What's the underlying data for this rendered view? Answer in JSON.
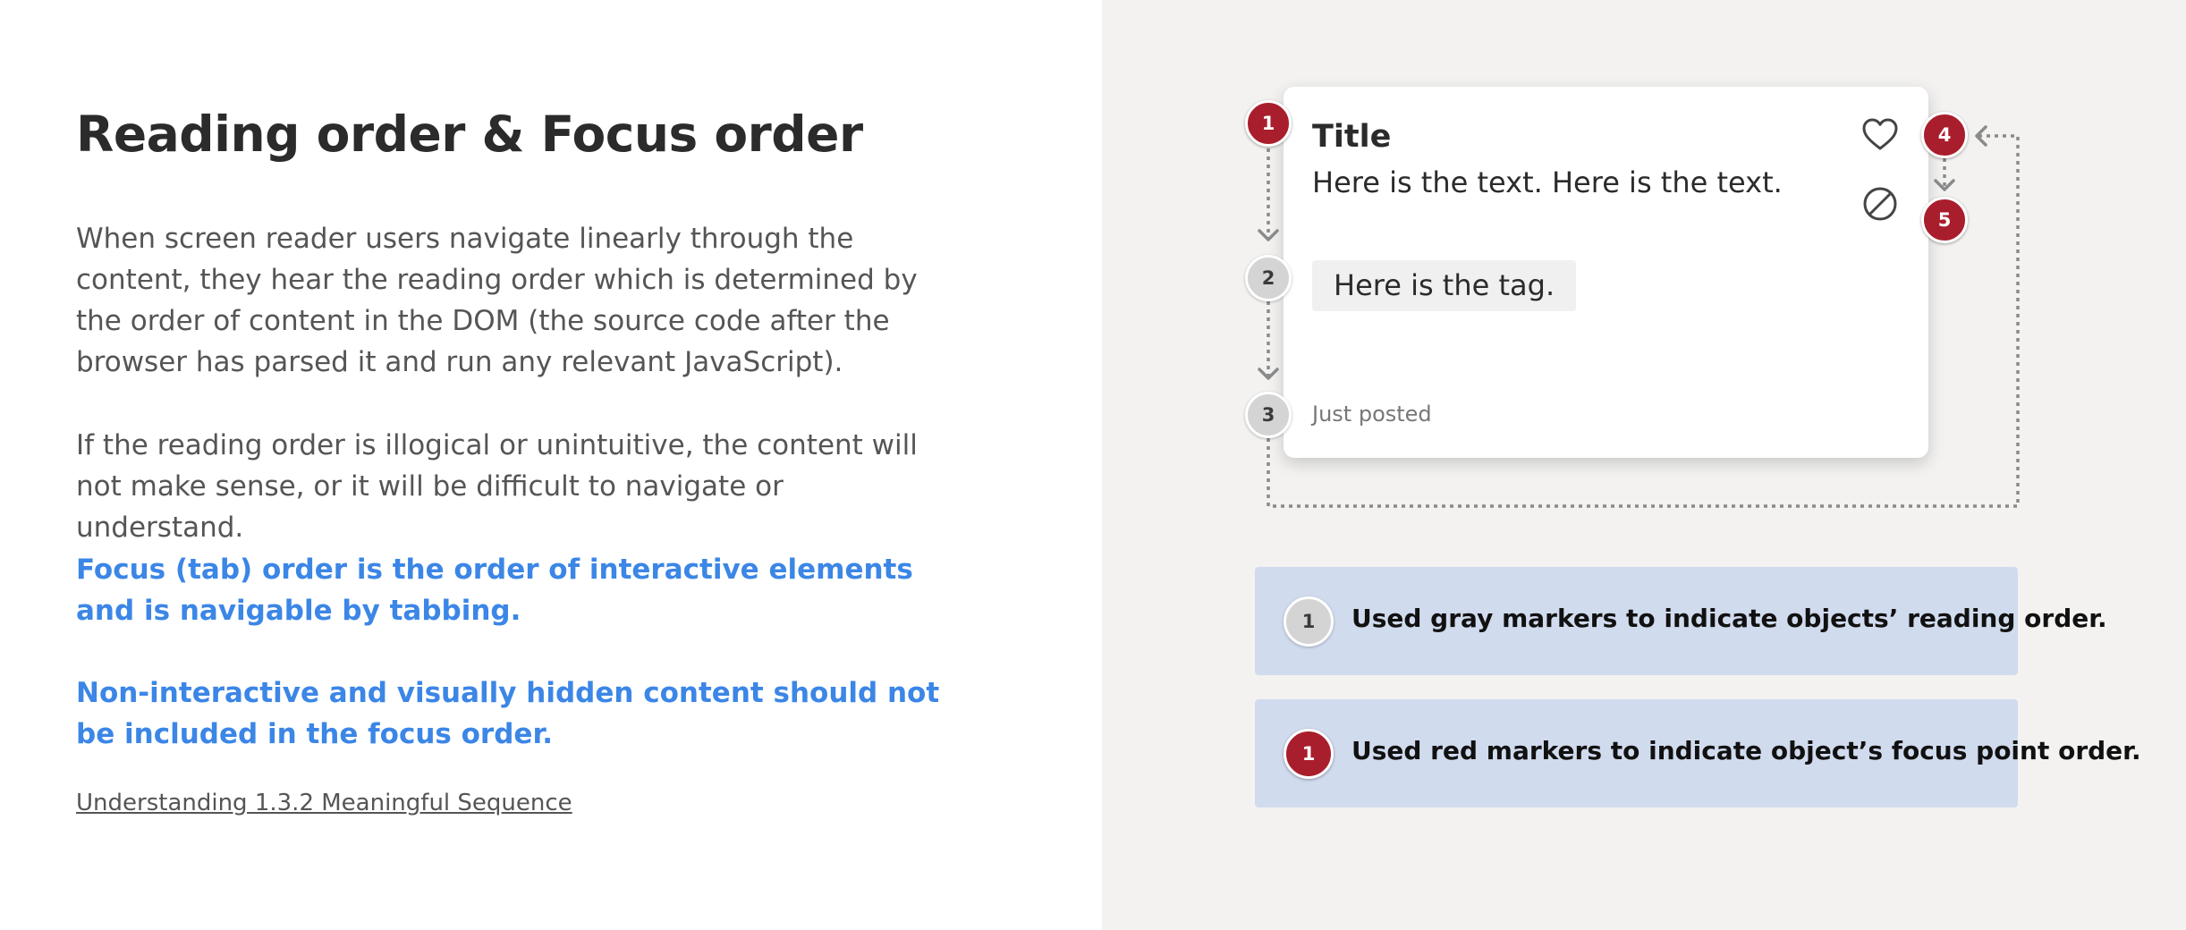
{
  "left": {
    "title": "Reading order & Focus order",
    "paragraph_1": "When screen reader users navigate linearly through the content, they hear the reading order which is determined by the order of content in the DOM (the source code after the browser has parsed it and run any relevant JavaScript).",
    "paragraph_2": "If the reading order is illogical or unintuitive, the content will not make sense, or it will be difficult to navigate or understand.",
    "highlight_1": "Focus (tab) order is the order of interactive elements and is navigable by tabbing.",
    "highlight_2": "Non-interactive and visually hidden content should not be included in the focus order.",
    "link": "Understanding 1.3.2 Meaningful Sequence"
  },
  "card": {
    "title": "Title",
    "text": "Here is the text. Here is the text.",
    "tag": "Here is the tag.",
    "timestamp": "Just posted",
    "icons": [
      "heart-icon",
      "block-icon"
    ]
  },
  "markers": {
    "focus_1": "1",
    "reading_2": "2",
    "reading_3": "3",
    "focus_4": "4",
    "focus_5": "5"
  },
  "legend": [
    {
      "marker": "1",
      "text": "Used gray markers to indicate objects’ reading order."
    },
    {
      "marker": "1",
      "text": "Used red markers to indicate object’s focus point order."
    }
  ],
  "colors": {
    "focus_marker": "#a91e2c",
    "reading_marker": "#d4d4d4",
    "highlight_text": "#3b86e6",
    "legend_bg": "#d1dbee",
    "right_pane_bg": "#f3f2f1"
  }
}
